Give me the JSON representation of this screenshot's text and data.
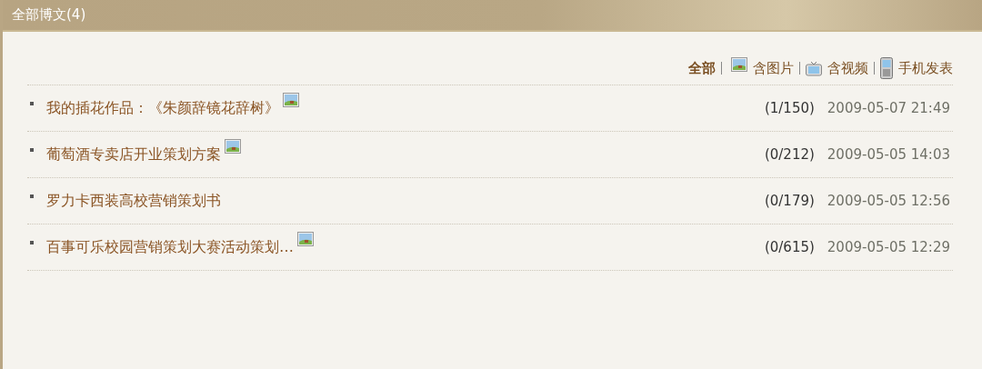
{
  "panel": {
    "title": "全部博文",
    "count": "(4)"
  },
  "filters": [
    {
      "label": "全部",
      "kind": "all",
      "selected": true
    },
    {
      "label": "含图片",
      "kind": "picture",
      "selected": false
    },
    {
      "label": "含视频",
      "kind": "video",
      "selected": false
    },
    {
      "label": "手机发表",
      "kind": "mobile",
      "selected": false
    }
  ],
  "posts": [
    {
      "title": "我的插花作品：《朱颜辞镜花辞树》",
      "has_image": true,
      "stats": "(1/150)",
      "date": "2009-05-07 21:49"
    },
    {
      "title": "葡萄酒专卖店开业策划方案",
      "has_image": true,
      "stats": "(0/212)",
      "date": "2009-05-05 14:03"
    },
    {
      "title": "罗力卡西装高校营销策划书",
      "has_image": false,
      "stats": "(0/179)",
      "date": "2009-05-05 12:56"
    },
    {
      "title": "百事可乐校园营销策划大赛活动策划…",
      "has_image": true,
      "stats": "(0/615)",
      "date": "2009-05-05 12:29"
    }
  ]
}
